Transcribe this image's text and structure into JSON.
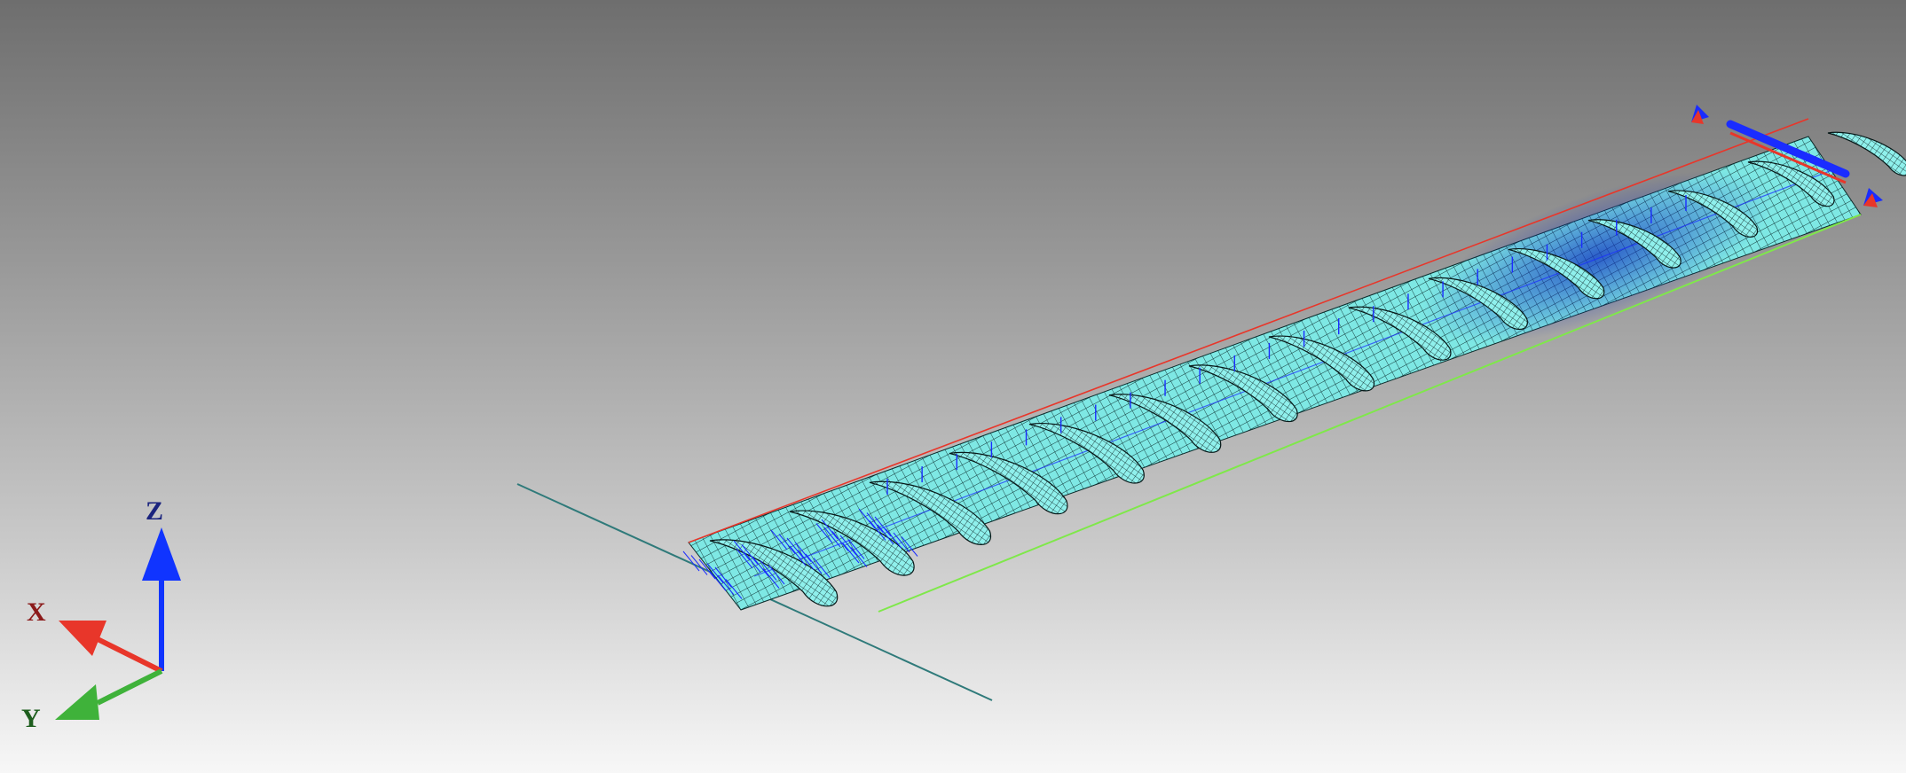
{
  "triad": {
    "x_label": "X",
    "y_label": "Y",
    "z_label": "Z",
    "x_color": "#e8362a",
    "y_color": "#3fb23a",
    "z_color": "#1034ff",
    "x_label_color": "#8b1a1a",
    "y_label_color": "#1e5e1e",
    "z_label_color": "#1a237e"
  },
  "model": {
    "mesh_fill_color": "#7ee8e4",
    "mesh_line_color": "#0a2a2a",
    "leading_edge_color": "#e8362a",
    "trailing_edge_color": "#7fe84a",
    "root_axis_color": "#2f7a7a",
    "load_arrow_color": "#1a2cff",
    "rib_count": 15
  }
}
